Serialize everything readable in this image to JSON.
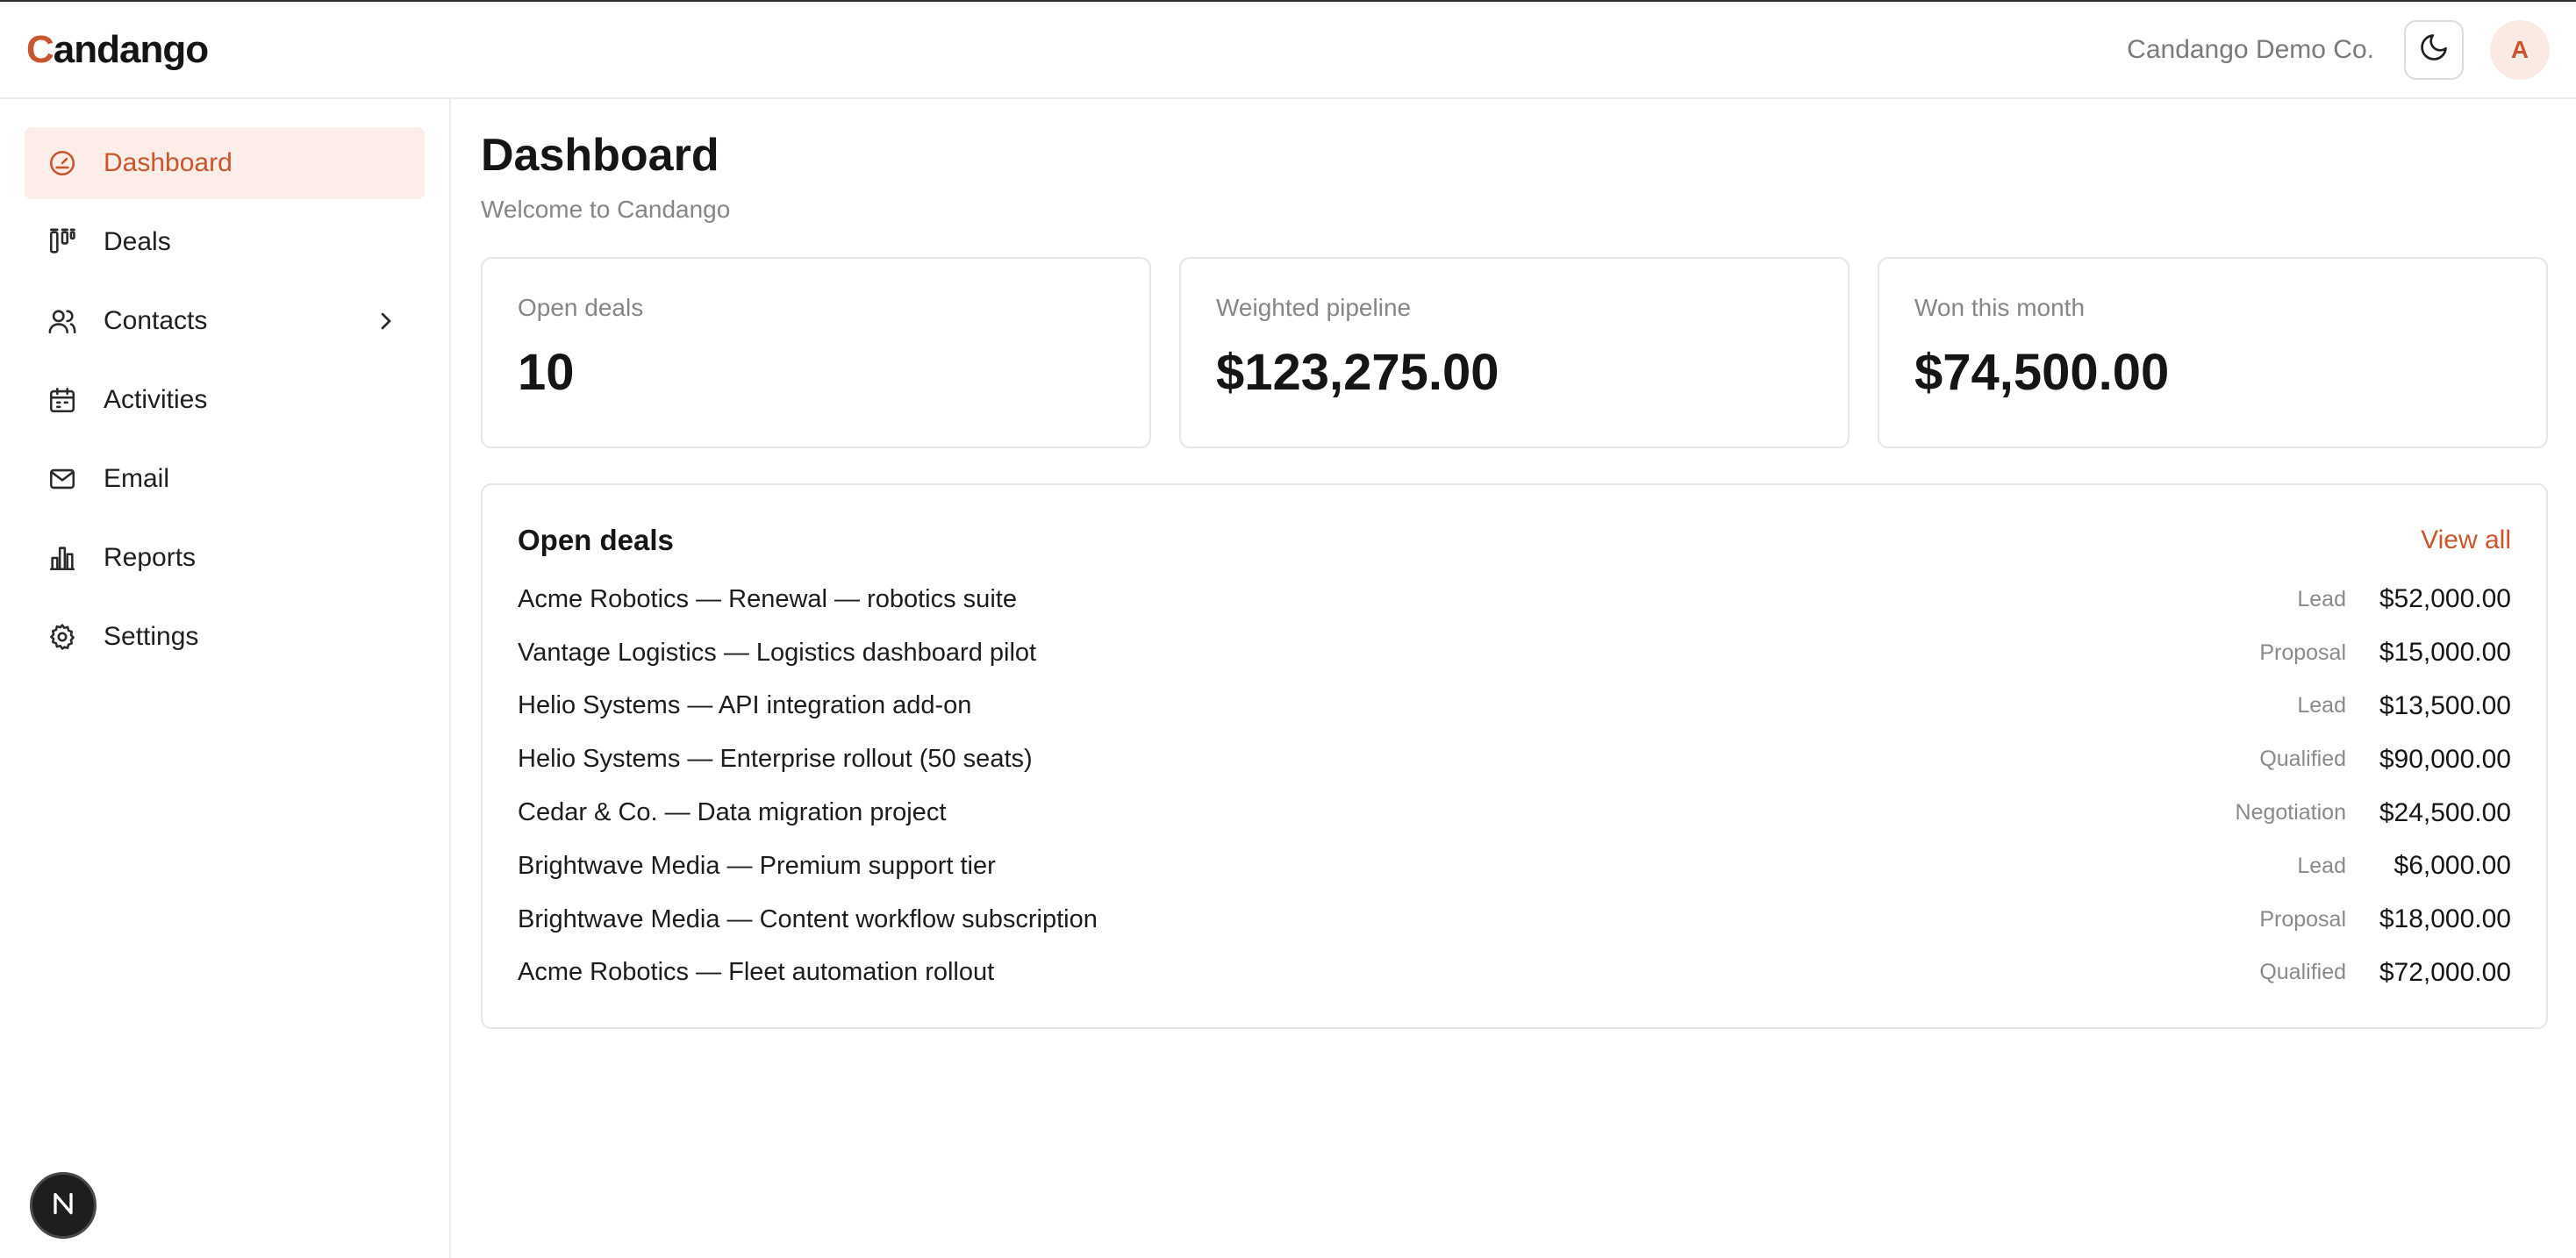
{
  "colors": {
    "accent": "#c8562f",
    "accent_bg": "#fcede8",
    "muted": "#868686",
    "border": "#e6e6e6"
  },
  "header": {
    "logo_initial": "C",
    "logo_rest": "andango",
    "org_name": "Candango Demo Co.",
    "theme_toggle_icon": "moon-icon",
    "avatar_initial": "A"
  },
  "sidebar": {
    "items": [
      {
        "label": "Dashboard",
        "icon": "gauge-icon",
        "active": true
      },
      {
        "label": "Deals",
        "icon": "kanban-icon"
      },
      {
        "label": "Contacts",
        "icon": "users-icon",
        "has_chevron": true
      },
      {
        "label": "Activities",
        "icon": "calendar-icon"
      },
      {
        "label": "Email",
        "icon": "mail-icon"
      },
      {
        "label": "Reports",
        "icon": "bar-chart-icon"
      },
      {
        "label": "Settings",
        "icon": "gear-icon"
      }
    ],
    "dev_badge": "N"
  },
  "main": {
    "title": "Dashboard",
    "subtitle": "Welcome to Candango",
    "stats": [
      {
        "label": "Open deals",
        "value": "10"
      },
      {
        "label": "Weighted pipeline",
        "value": "$123,275.00"
      },
      {
        "label": "Won this month",
        "value": "$74,500.00"
      }
    ],
    "open_deals": {
      "title": "Open deals",
      "view_all": "View all",
      "rows": [
        {
          "name": "Acme Robotics — Renewal — robotics suite",
          "stage": "Lead",
          "amount": "$52,000.00"
        },
        {
          "name": "Vantage Logistics — Logistics dashboard pilot",
          "stage": "Proposal",
          "amount": "$15,000.00"
        },
        {
          "name": "Helio Systems — API integration add-on",
          "stage": "Lead",
          "amount": "$13,500.00"
        },
        {
          "name": "Helio Systems — Enterprise rollout (50 seats)",
          "stage": "Qualified",
          "amount": "$90,000.00"
        },
        {
          "name": "Cedar & Co. — Data migration project",
          "stage": "Negotiation",
          "amount": "$24,500.00"
        },
        {
          "name": "Brightwave Media — Premium support tier",
          "stage": "Lead",
          "amount": "$6,000.00"
        },
        {
          "name": "Brightwave Media — Content workflow subscription",
          "stage": "Proposal",
          "amount": "$18,000.00"
        },
        {
          "name": "Acme Robotics — Fleet automation rollout",
          "stage": "Qualified",
          "amount": "$72,000.00"
        }
      ]
    }
  }
}
